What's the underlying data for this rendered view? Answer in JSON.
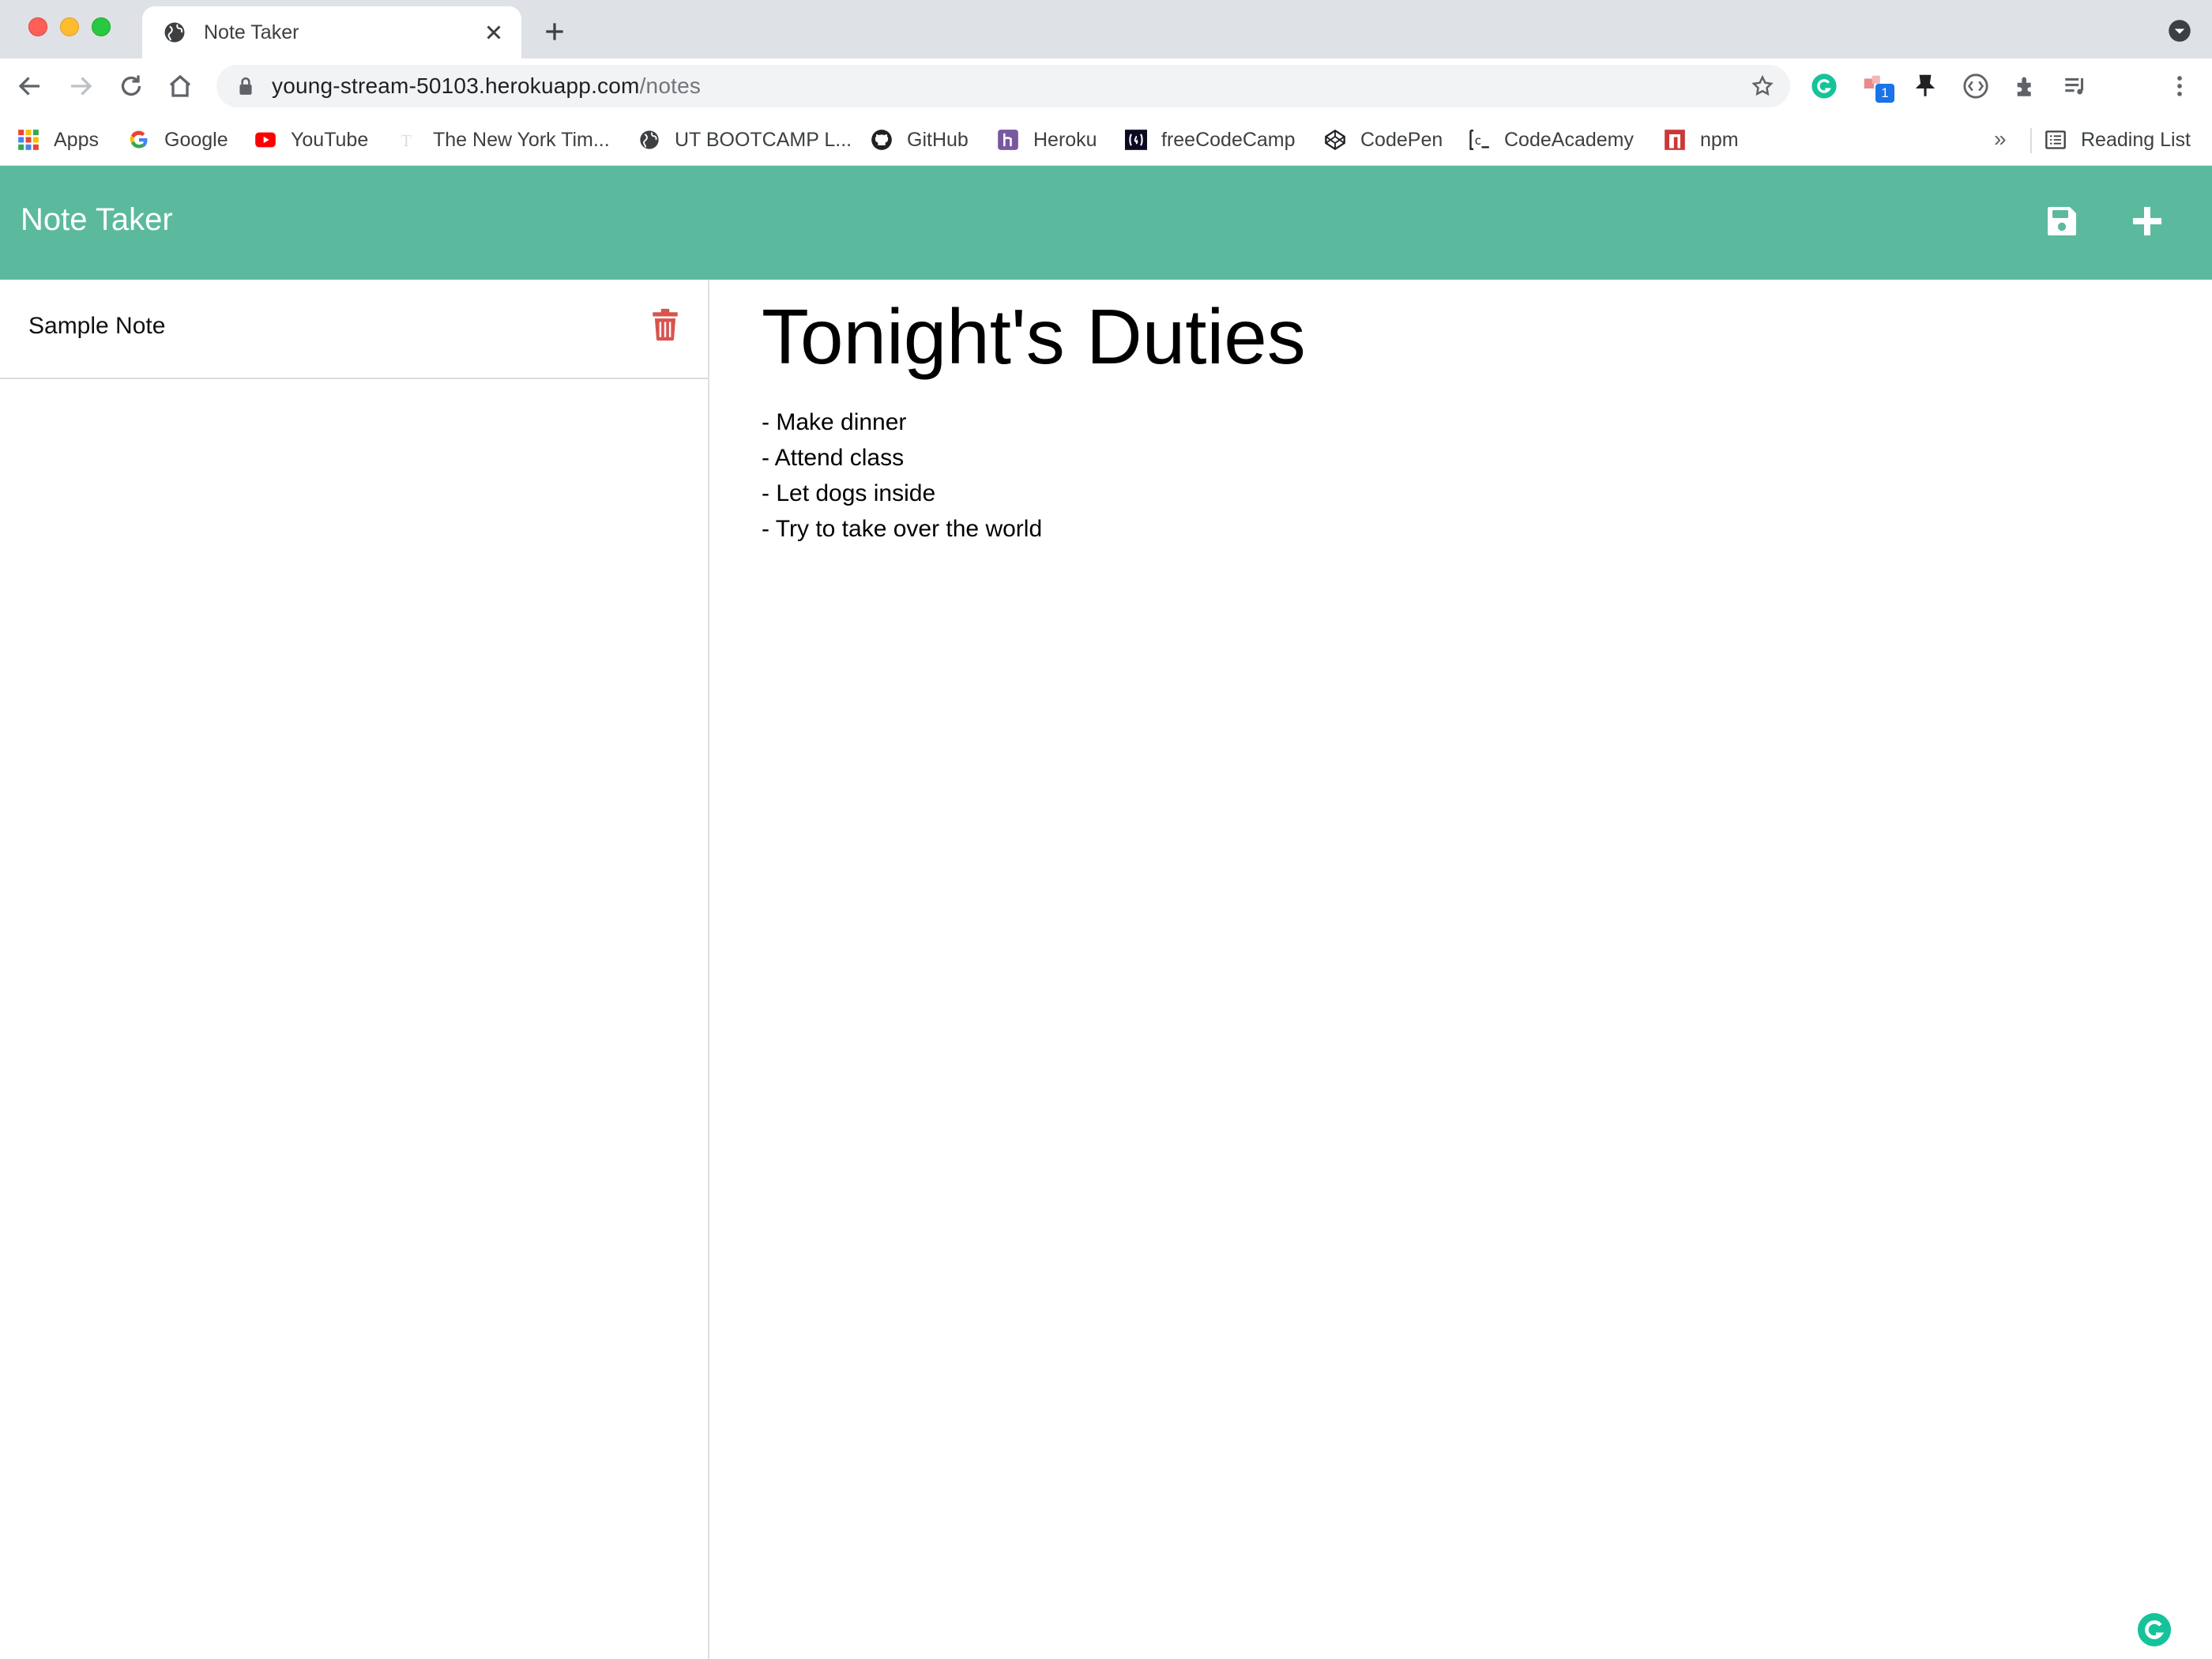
{
  "browser": {
    "tab_title": "Note Taker",
    "url_host": "young-stream-50103.herokuapp.com",
    "url_path": "/notes",
    "extension_badge": "1",
    "bookmarks": [
      {
        "label": "Apps",
        "icon": "apps-grid-icon"
      },
      {
        "label": "Google",
        "icon": "google-icon"
      },
      {
        "label": "YouTube",
        "icon": "youtube-icon"
      },
      {
        "label": "The New York Tim...",
        "icon": "nyt-icon"
      },
      {
        "label": "UT BOOTCAMP L...",
        "icon": "globe-icon"
      },
      {
        "label": "GitHub",
        "icon": "github-icon"
      },
      {
        "label": "Heroku",
        "icon": "heroku-icon"
      },
      {
        "label": "freeCodeCamp",
        "icon": "freecodecamp-icon"
      },
      {
        "label": "CodePen",
        "icon": "codepen-icon"
      },
      {
        "label": "CodeAcademy",
        "icon": "codecademy-icon"
      },
      {
        "label": "npm",
        "icon": "npm-icon"
      }
    ],
    "more_label": "»",
    "reading_list": "Reading List"
  },
  "app": {
    "brand": "Note Taker",
    "notes": [
      {
        "title": "Sample Note"
      }
    ],
    "active_note": {
      "title": "Tonight's Duties",
      "lines": [
        "- Make dinner",
        "- Attend class",
        "- Let dogs inside",
        "- Try to take over the world"
      ]
    }
  },
  "colors": {
    "header": "#5bba9d",
    "delete": "#d9534f",
    "tab_strip": "#dee1e6"
  }
}
